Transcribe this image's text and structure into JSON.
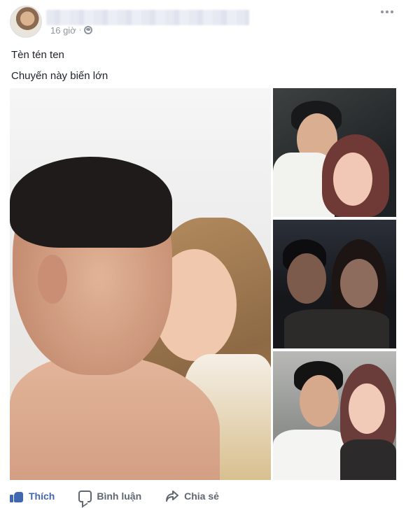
{
  "post": {
    "timestamp": "16 giờ",
    "separator": "·",
    "privacy_icon": "globe-icon",
    "options_icon": "more-options-icon",
    "lines": [
      "Tèn tén ten",
      "Chuyến này biến lớn"
    ]
  },
  "photos": {
    "main_icon": "photo",
    "thumbnails": [
      "thumbnail-1",
      "thumbnail-2",
      "thumbnail-3"
    ]
  },
  "actions": {
    "like_label": "Thích",
    "comment_label": "Bình luận",
    "share_label": "Chia sẻ"
  },
  "colors": {
    "accent": "#4267b2",
    "muted": "#90949c",
    "action_text": "#606770"
  }
}
